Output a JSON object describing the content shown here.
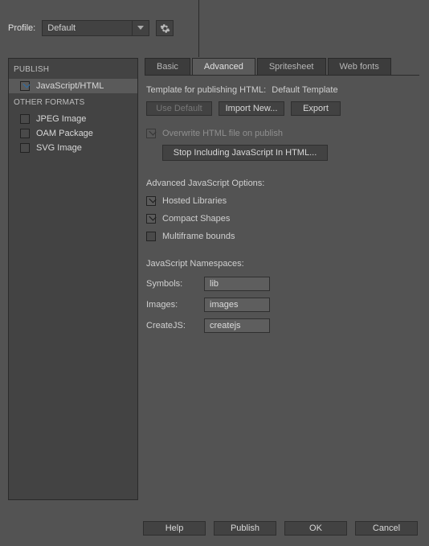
{
  "profile": {
    "label": "Profile:",
    "selected": "Default"
  },
  "sidebar": {
    "heading_publish": "PUBLISH",
    "heading_other": "OTHER FORMATS",
    "items": [
      {
        "label": "JavaScript/HTML",
        "checked": true,
        "selected": true
      },
      {
        "label": "JPEG Image",
        "checked": false,
        "selected": false
      },
      {
        "label": "OAM Package",
        "checked": false,
        "selected": false
      },
      {
        "label": "SVG Image",
        "checked": false,
        "selected": false
      }
    ]
  },
  "tabs": {
    "items": [
      "Basic",
      "Advanced",
      "Spritesheet",
      "Web fonts"
    ],
    "active": 1
  },
  "template": {
    "label": "Template for publishing HTML:",
    "value": "Default Template",
    "use_default": "Use Default",
    "import_new": "Import New...",
    "export": "Export"
  },
  "overwrite": {
    "label": "Overwrite HTML file on publish",
    "checked": true,
    "disabled": true
  },
  "stop_button": "Stop Including JavaScript In HTML...",
  "adv_heading": "Advanced JavaScript Options:",
  "options": [
    {
      "label": "Hosted Libraries",
      "checked": true
    },
    {
      "label": "Compact Shapes",
      "checked": true
    },
    {
      "label": "Multiframe bounds",
      "checked": false
    }
  ],
  "ns": {
    "heading": "JavaScript Namespaces:",
    "symbols": {
      "label": "Symbols:",
      "value": "lib"
    },
    "images": {
      "label": "Images:",
      "value": "images"
    },
    "createjs": {
      "label": "CreateJS:",
      "value": "createjs"
    }
  },
  "footer": {
    "help": "Help",
    "publish": "Publish",
    "ok": "OK",
    "cancel": "Cancel"
  }
}
